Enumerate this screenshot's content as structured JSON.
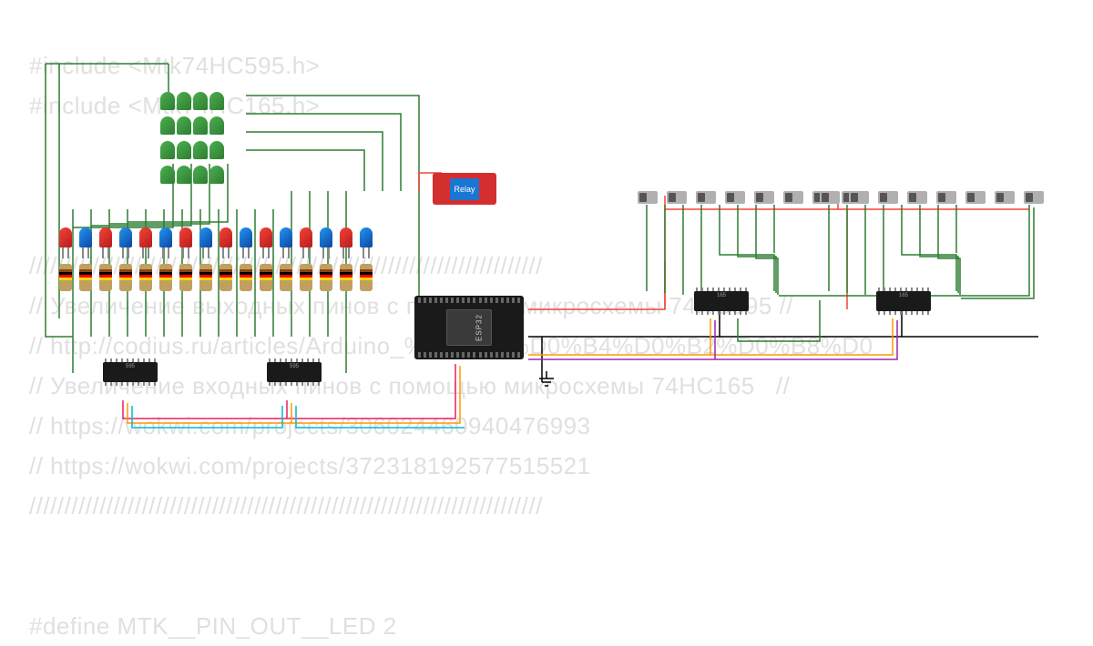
{
  "code_lines": [
    "#include <Mtk74HC595.h>",
    "#include <Mtk74HC165.h>",
    "",
    "",
    "",
    "/////////////////////////////////////////////////////////////////////////",
    "// Увеличение выходных пинов с помощью микросхемы 74HC595 //",
    "// http://codius.ru/articles/Arduino_%D0%A1%D0%B4%D0%B2%D0%B8%D0",
    "// Увеличение входных пинов с помощью микросхемы 74HC165   //",
    "// https://wokwi.com/projects/306024460940476993",
    "// https://wokwi.com/projects/372318192577515521",
    "/////////////////////////////////////////////////////////////////////////",
    "",
    "",
    "#define MTK__PIN_OUT__LED 2"
  ],
  "components": {
    "relay_label": "Relay",
    "esp32_label": "ESP32",
    "chip595_label": "595",
    "chip165_label": "165"
  },
  "led_colors_row": [
    "red",
    "blue",
    "red",
    "blue",
    "red",
    "blue",
    "red",
    "blue",
    "red",
    "blue",
    "red",
    "blue",
    "red",
    "blue",
    "red",
    "blue"
  ],
  "grid_rows": 4,
  "grid_cols": 4,
  "switch_count_left": 8,
  "switch_count_right": 8,
  "resistor_count": 16,
  "esp_pin_count": 19
}
